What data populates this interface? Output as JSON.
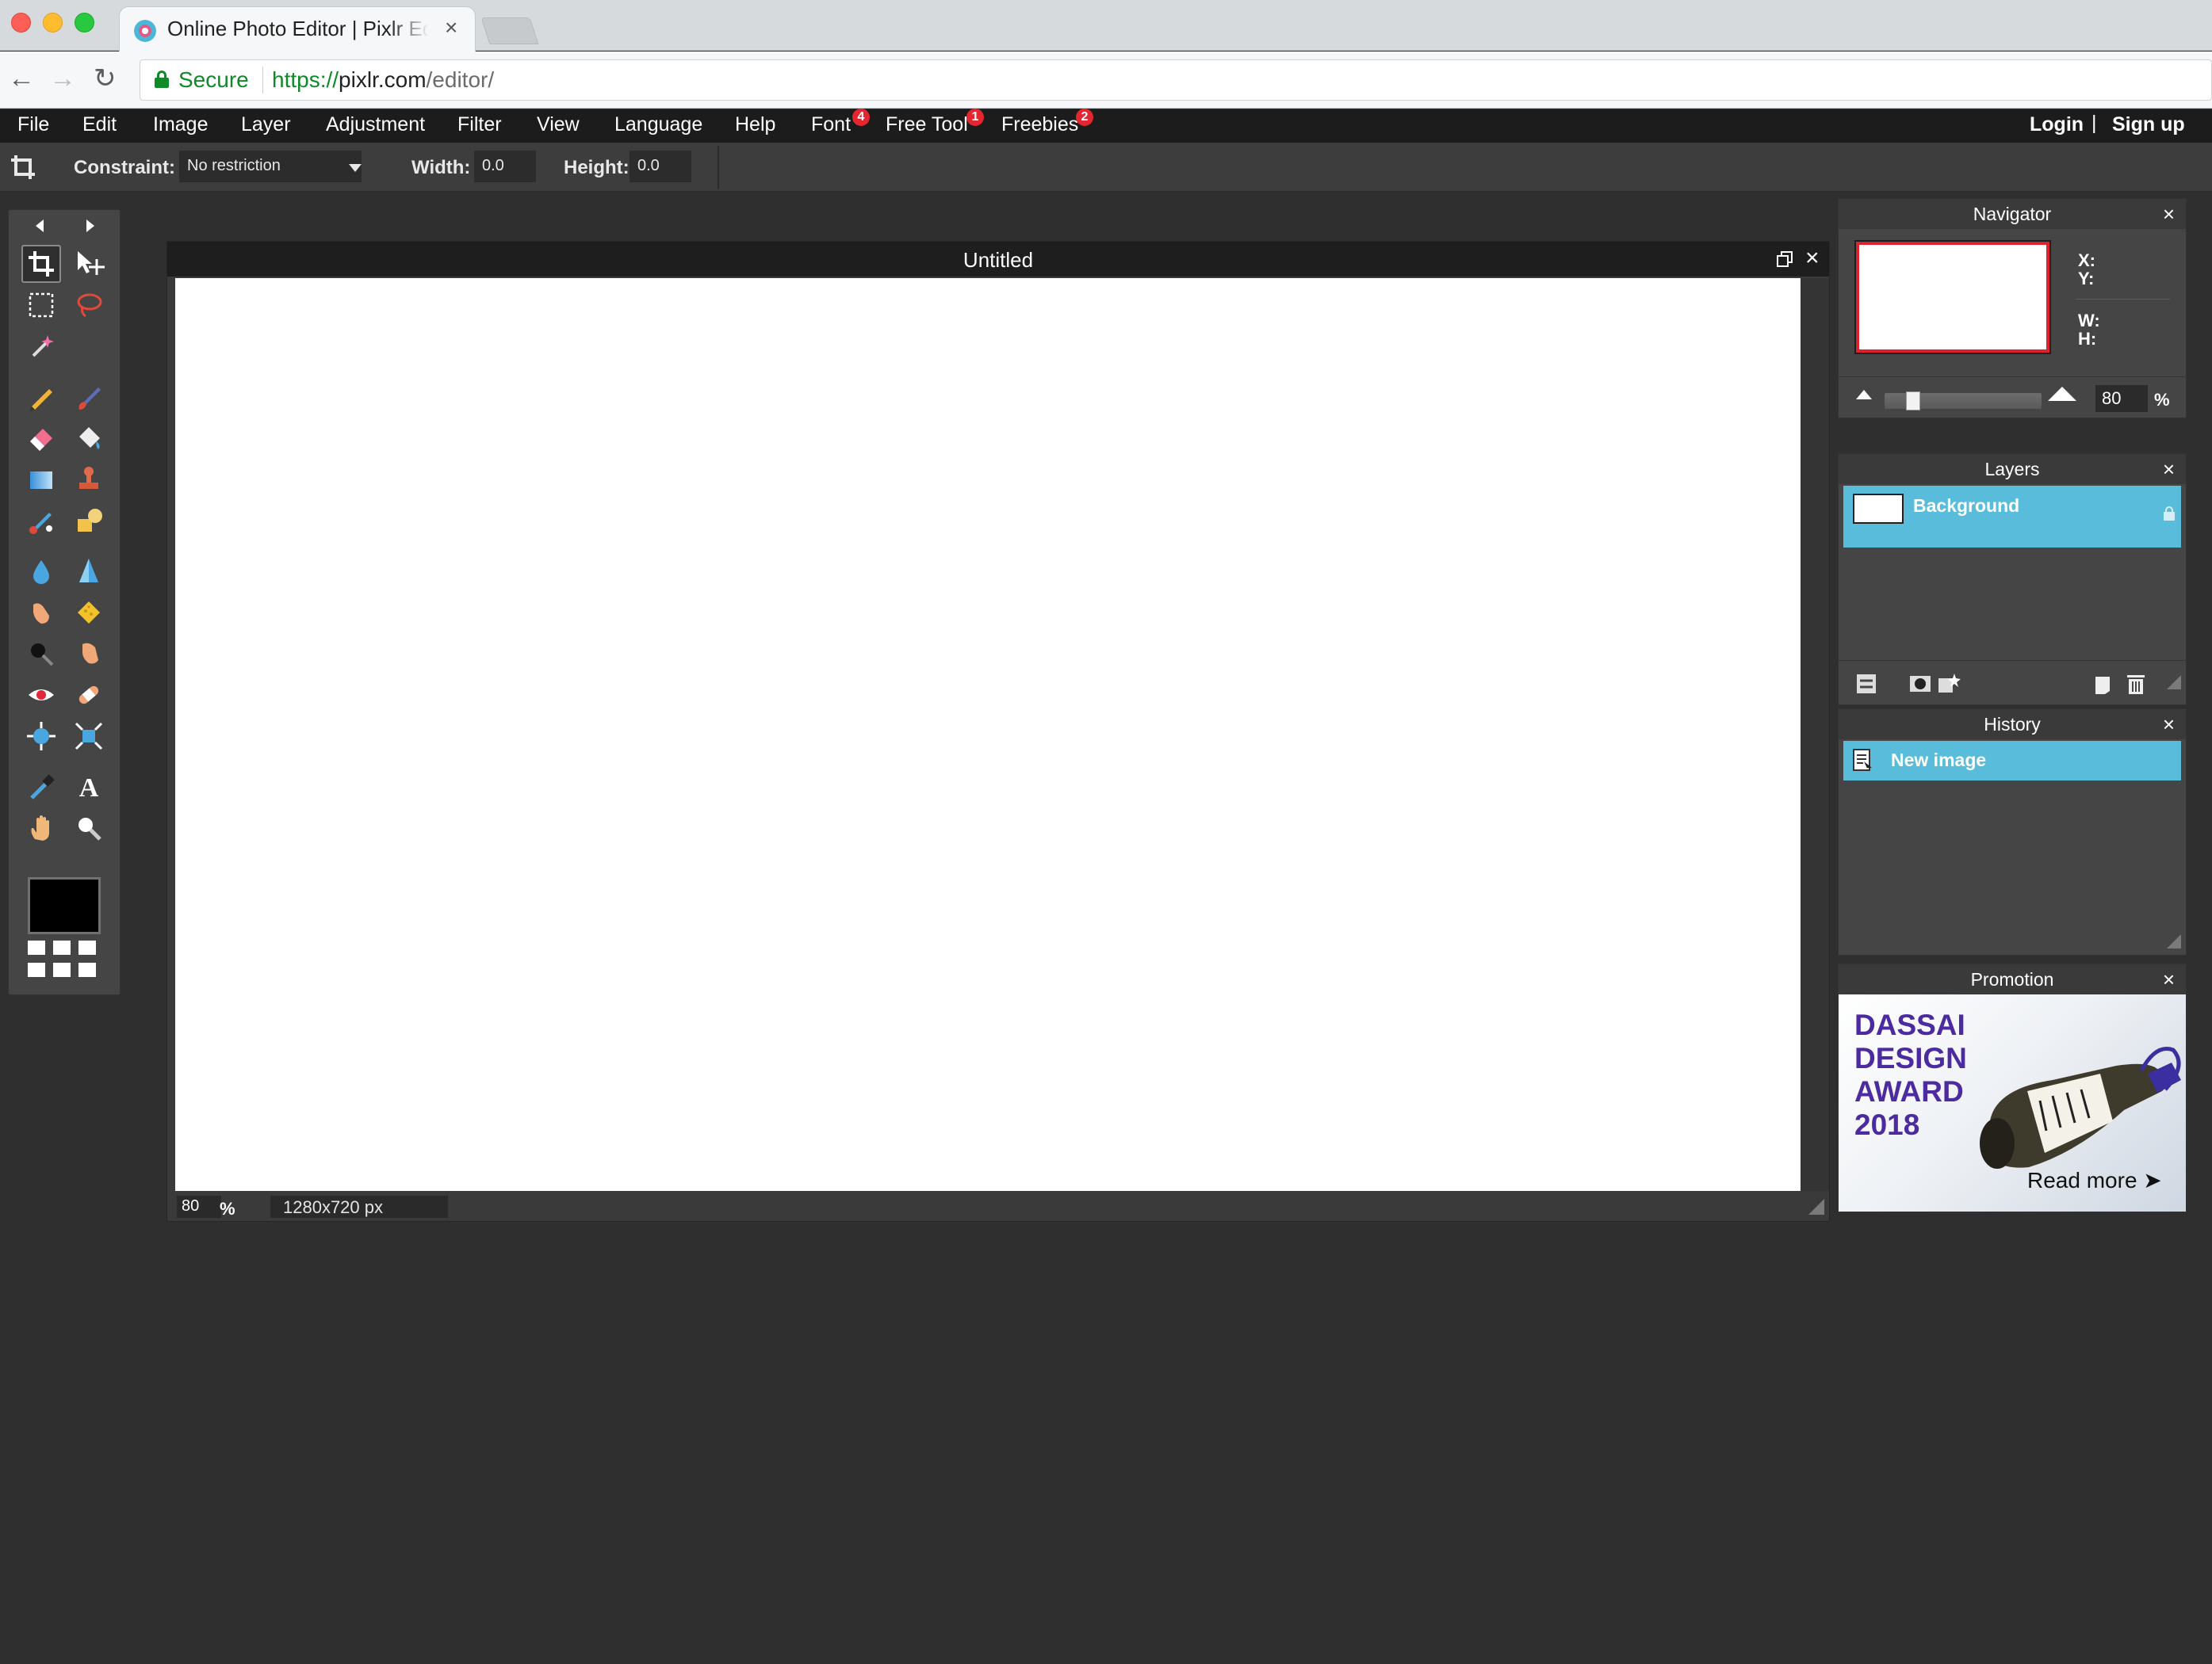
{
  "browser": {
    "tab_title": "Online Photo Editor | Pixlr Editor",
    "tab_close": "×",
    "secure_label": "Secure",
    "url_scheme": "https://",
    "url_host": "pixlr.com",
    "url_path": "/editor/"
  },
  "menubar": {
    "items": [
      {
        "label": "File"
      },
      {
        "label": "Edit"
      },
      {
        "label": "Image"
      },
      {
        "label": "Layer"
      },
      {
        "label": "Adjustment"
      },
      {
        "label": "Filter"
      },
      {
        "label": "View"
      },
      {
        "label": "Language"
      },
      {
        "label": "Help"
      },
      {
        "label": "Font",
        "badge": "4"
      },
      {
        "label": "Free Tool",
        "badge": "1"
      },
      {
        "label": "Freebies",
        "badge": "2"
      }
    ],
    "login": "Login",
    "separator": "|",
    "signup": "Sign up"
  },
  "options": {
    "constraint_label": "Constraint:",
    "constraint_value": "No restriction",
    "width_label": "Width:",
    "width_value": "0.0",
    "height_label": "Height:",
    "height_value": "0.0"
  },
  "toolbox": {
    "active_tool": "crop",
    "foreground_color": "#000000",
    "tools": [
      "crop",
      "move",
      "marquee",
      "lasso",
      "wand",
      "pencil",
      "brush",
      "eraser",
      "paint-bucket",
      "gradient",
      "clone-stamp",
      "color-replace",
      "drawing",
      "blur",
      "sharpen",
      "smudge",
      "sponge",
      "dodge",
      "burn",
      "red-eye",
      "spot-heal",
      "bloat",
      "pinch",
      "color-picker",
      "type",
      "hand",
      "zoom"
    ]
  },
  "document": {
    "title": "Untitled",
    "close": "×",
    "zoom": "80",
    "zoom_unit": "%",
    "size": "1280x720 px"
  },
  "navigator": {
    "title": "Navigator",
    "close": "×",
    "x_label": "X:",
    "y_label": "Y:",
    "w_label": "W:",
    "h_label": "H:",
    "zoom": "80",
    "zoom_unit": "%",
    "zoom_level": 0.15
  },
  "layers": {
    "title": "Layers",
    "close": "×",
    "items": [
      {
        "name": "Background",
        "locked": true
      }
    ]
  },
  "history": {
    "title": "History",
    "close": "×",
    "items": [
      {
        "label": "New image"
      }
    ]
  },
  "promotion": {
    "title": "Promotion",
    "close": "×",
    "headline": "DASSAI DESIGN AWARD 2018",
    "cta": "Read more ➤"
  },
  "colors": {
    "app_bg": "#2f2f2f",
    "menubar_bg": "#1c1c1c",
    "panel_bg": "#454545",
    "selection": "#58bcda",
    "promo_text": "#4c2aa0",
    "secure_green": "#108a29"
  }
}
